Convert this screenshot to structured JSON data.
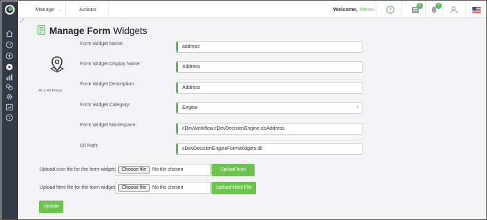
{
  "topbar": {
    "menu": [
      {
        "label": "Manage",
        "has_dropdown": true
      },
      {
        "label": "Actions",
        "has_dropdown": false
      }
    ],
    "welcome_label": "Welcome,",
    "user_name": "Admin",
    "icons": [
      {
        "name": "help-icon"
      },
      {
        "name": "tasks-icon",
        "badge": "6"
      },
      {
        "name": "bell-icon",
        "badge": "1"
      },
      {
        "name": "user-settings-icon"
      },
      {
        "name": "us-flag-icon"
      }
    ]
  },
  "sidebar": {
    "items": [
      {
        "name": "home-icon"
      },
      {
        "name": "dashboard-icon"
      },
      {
        "name": "add-icon"
      },
      {
        "name": "play-icon",
        "active": true
      },
      {
        "name": "chart-icon"
      },
      {
        "name": "link-icon"
      },
      {
        "name": "gear-icon"
      },
      {
        "name": "report-icon"
      },
      {
        "name": "help-icon"
      }
    ]
  },
  "page": {
    "title_bold": "Manage Form",
    "title_rest": "Widgets",
    "image_size_label": "40 x 40 Pixels"
  },
  "form": {
    "fields": [
      {
        "label": "Form Widget Name:",
        "value": "address"
      },
      {
        "label": "Form Widget Display Name:",
        "value": "Address"
      },
      {
        "label": "Form Widget Description:",
        "value": "Address"
      },
      {
        "label": "Form Widget Category:",
        "value": "Engine",
        "type": "select"
      },
      {
        "label": "Form Widget Namespace:",
        "value": "cDevWorkflow.cDevDecisionEngine.clsAddress"
      },
      {
        "label": "Dll Path:",
        "value": "cDevDecisionEngineFormWidgets.dll"
      }
    ],
    "upload_icon": {
      "label": "Upload icon file for the form widget:",
      "choose_label": "Choose file",
      "status": "No file chosen",
      "button": "Upload Icon"
    },
    "upload_html": {
      "label": "Upload html file for the form widget:",
      "choose_label": "Choose file",
      "status": "No file chosen",
      "button": "Upload Html File"
    },
    "submit_label": "Update"
  },
  "colors": {
    "accent": "#6cc44f",
    "sidebar_bg": "#313a46",
    "content_bg": "#f3f3f6"
  }
}
